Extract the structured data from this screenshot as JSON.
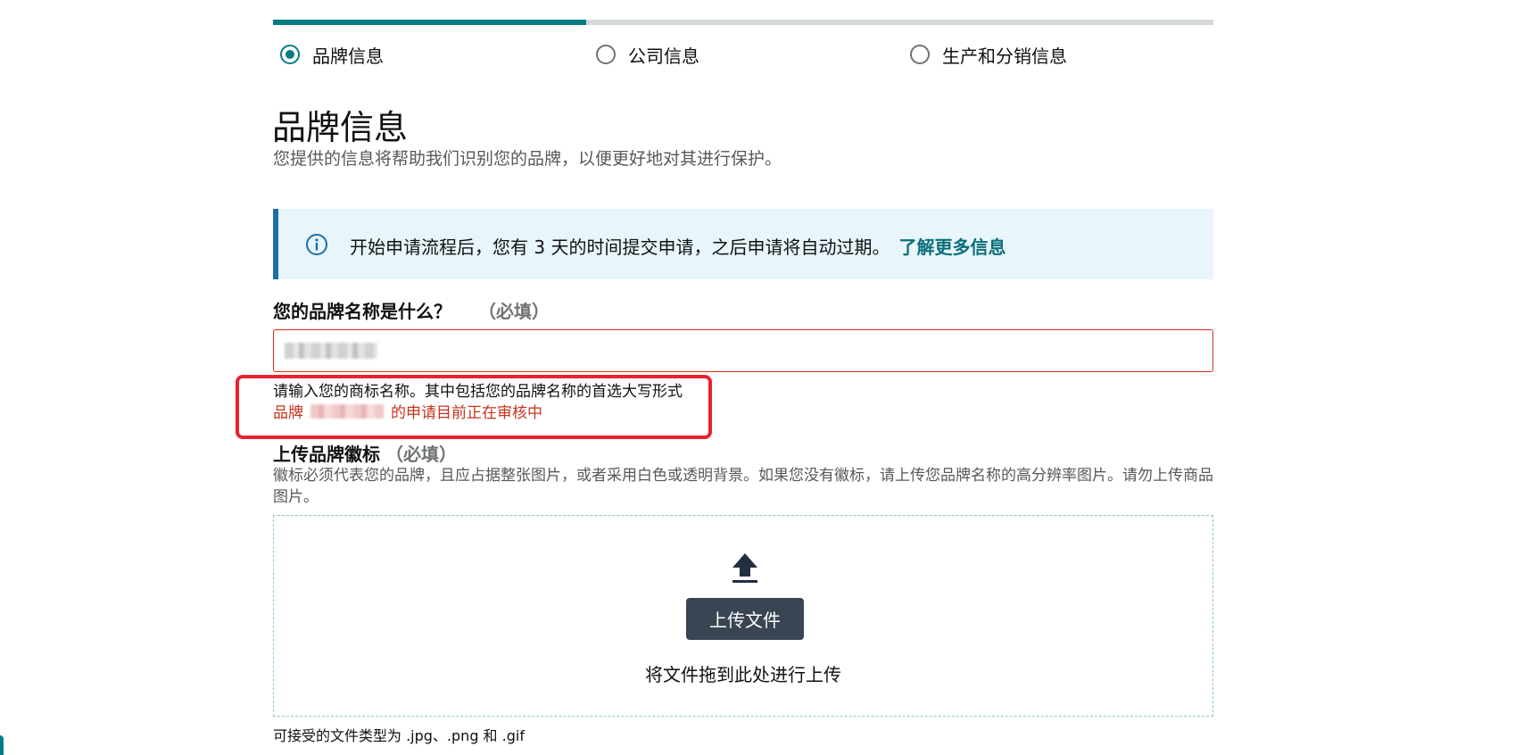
{
  "progress": {
    "current_step": 1,
    "total_steps": 3,
    "fraction_complete": 0.333
  },
  "steps": [
    {
      "label": "品牌信息",
      "active": true
    },
    {
      "label": "公司信息",
      "active": false
    },
    {
      "label": "生产和分销信息",
      "active": false
    }
  ],
  "page": {
    "title": "品牌信息",
    "subtitle": "您提供的信息将帮助我们识别您的品牌，以便更好地对其进行保护。"
  },
  "info_box": {
    "icon": "info-icon",
    "text": "开始申请流程后，您有 3 天的时间提交申请，之后申请将自动过期。",
    "link_label": "了解更多信息"
  },
  "brand_name": {
    "label": "您的品牌名称是什么？",
    "required_label": "（必填）",
    "hint": "请输入您的商标名称。其中包括您的品牌名称的首选大写形式",
    "error_prefix": "品牌",
    "error_suffix": "的申请目前正在审核中"
  },
  "logo_upload": {
    "label": "上传品牌徽标",
    "required_label": "（必填）",
    "description": "徽标必须代表您的品牌，且应占据整张图片，或者采用白色或透明背景。如果您没有徽标，请上传您品牌名称的高分辨率图片。请勿上传商品图片。",
    "button_label": "上传文件",
    "drop_hint": "将文件拖到此处进行上传",
    "accepted_types": "可接受的文件类型为 .jpg、.png 和 .gif"
  },
  "colors": {
    "accent": "#067d86",
    "error": "#c7321b",
    "info_bg": "#e8f5fb",
    "info_border": "#1d6fa5",
    "annotation": "#e8232f",
    "button_bg": "#3a4553"
  }
}
